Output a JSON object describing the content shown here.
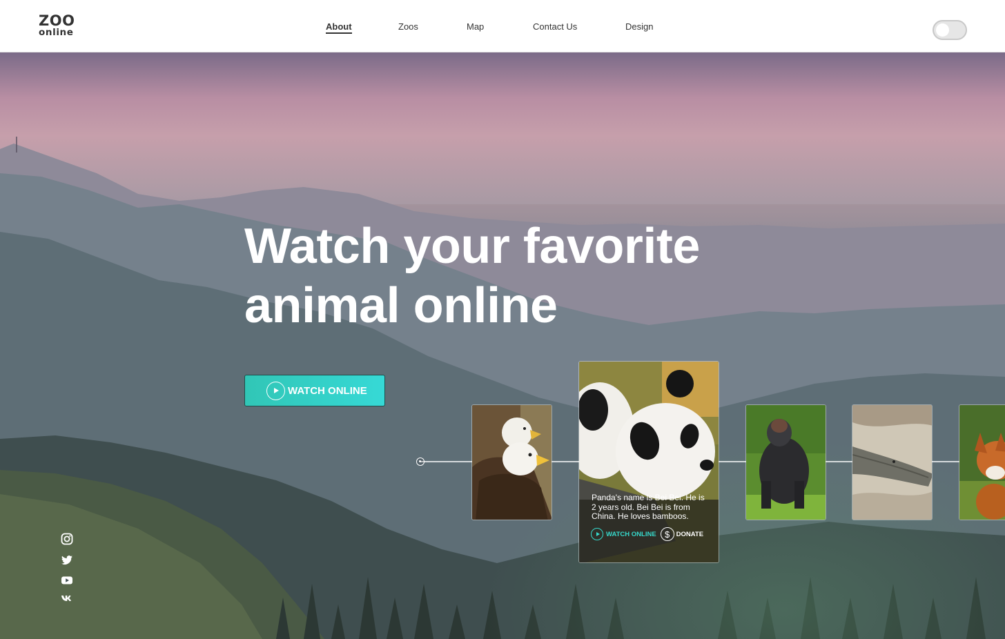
{
  "brand": {
    "line1": "ZOO",
    "line2": "online"
  },
  "nav": [
    {
      "label": "About",
      "active": true
    },
    {
      "label": "Zoos",
      "active": false
    },
    {
      "label": "Map",
      "active": false
    },
    {
      "label": "Contact Us",
      "active": false
    },
    {
      "label": "Design",
      "active": false
    }
  ],
  "theme_toggle": {
    "on": false
  },
  "hero": {
    "headline_line1": "Watch your favorite",
    "headline_line2": "animal online",
    "cta_label": "WATCH ONLINE"
  },
  "carousel": {
    "featured": {
      "animal": "panda",
      "description": "Panda's name is Bei Bei. He is 2 years old. Bei Bei is from China. He loves bamboos.",
      "watch_label": "WATCH ONLINE",
      "donate_label": "DONATE",
      "donate_symbol": "$"
    },
    "cards": [
      "eagle",
      "panda",
      "gorilla",
      "crocodile",
      "fox"
    ]
  },
  "social": [
    {
      "icon": "instagram-icon"
    },
    {
      "icon": "twitter-icon"
    },
    {
      "icon": "youtube-icon"
    },
    {
      "icon": "vk-icon"
    }
  ],
  "colors": {
    "accent": "#36d9cc",
    "text_dark": "#333333"
  }
}
